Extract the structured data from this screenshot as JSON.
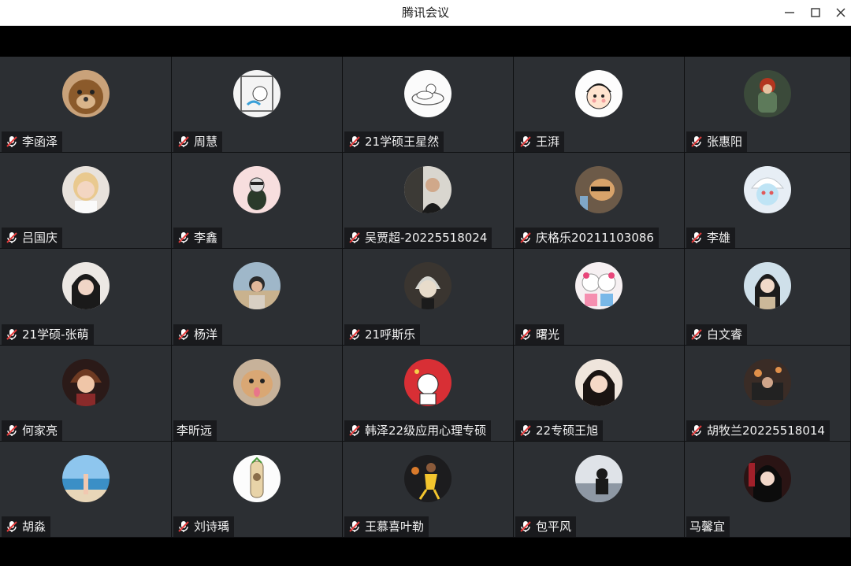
{
  "window": {
    "title": "腾讯会议",
    "controls": {
      "minimize_icon": "minimize-icon",
      "maximize_icon": "maximize-icon",
      "close_icon": "close-icon"
    }
  },
  "colors": {
    "tile_bg": "#2c2f33",
    "muted_mic_red": "#e23b3b",
    "title_bg": "#ffffff"
  },
  "participants": [
    {
      "name": "李函泽",
      "muted": true
    },
    {
      "name": "周慧",
      "muted": true
    },
    {
      "name": "21学硕王星然",
      "muted": true
    },
    {
      "name": "王湃",
      "muted": true
    },
    {
      "name": "张惠阳",
      "muted": true
    },
    {
      "name": "吕国庆",
      "muted": true
    },
    {
      "name": "李鑫",
      "muted": true
    },
    {
      "name": "吴贾超-20225518024",
      "muted": true
    },
    {
      "name": "庆格乐20211103086",
      "muted": true
    },
    {
      "name": "李雄",
      "muted": true
    },
    {
      "name": "21学硕-张萌",
      "muted": true
    },
    {
      "name": "杨洋",
      "muted": true
    },
    {
      "name": "21呼斯乐",
      "muted": true
    },
    {
      "name": "曙光",
      "muted": true
    },
    {
      "name": "白文睿",
      "muted": true
    },
    {
      "name": "何家亮",
      "muted": true
    },
    {
      "name": "李昕远",
      "muted": false
    },
    {
      "name": "韩泽22级应用心理专硕",
      "muted": true
    },
    {
      "name": "22专硕王旭",
      "muted": true
    },
    {
      "name": "胡牧兰20225518014",
      "muted": true
    },
    {
      "name": "胡淼",
      "muted": true
    },
    {
      "name": "刘诗瑀",
      "muted": true
    },
    {
      "name": "王慕喜叶勒",
      "muted": true
    },
    {
      "name": "包平风",
      "muted": true
    },
    {
      "name": "马馨宜",
      "muted": false
    }
  ]
}
